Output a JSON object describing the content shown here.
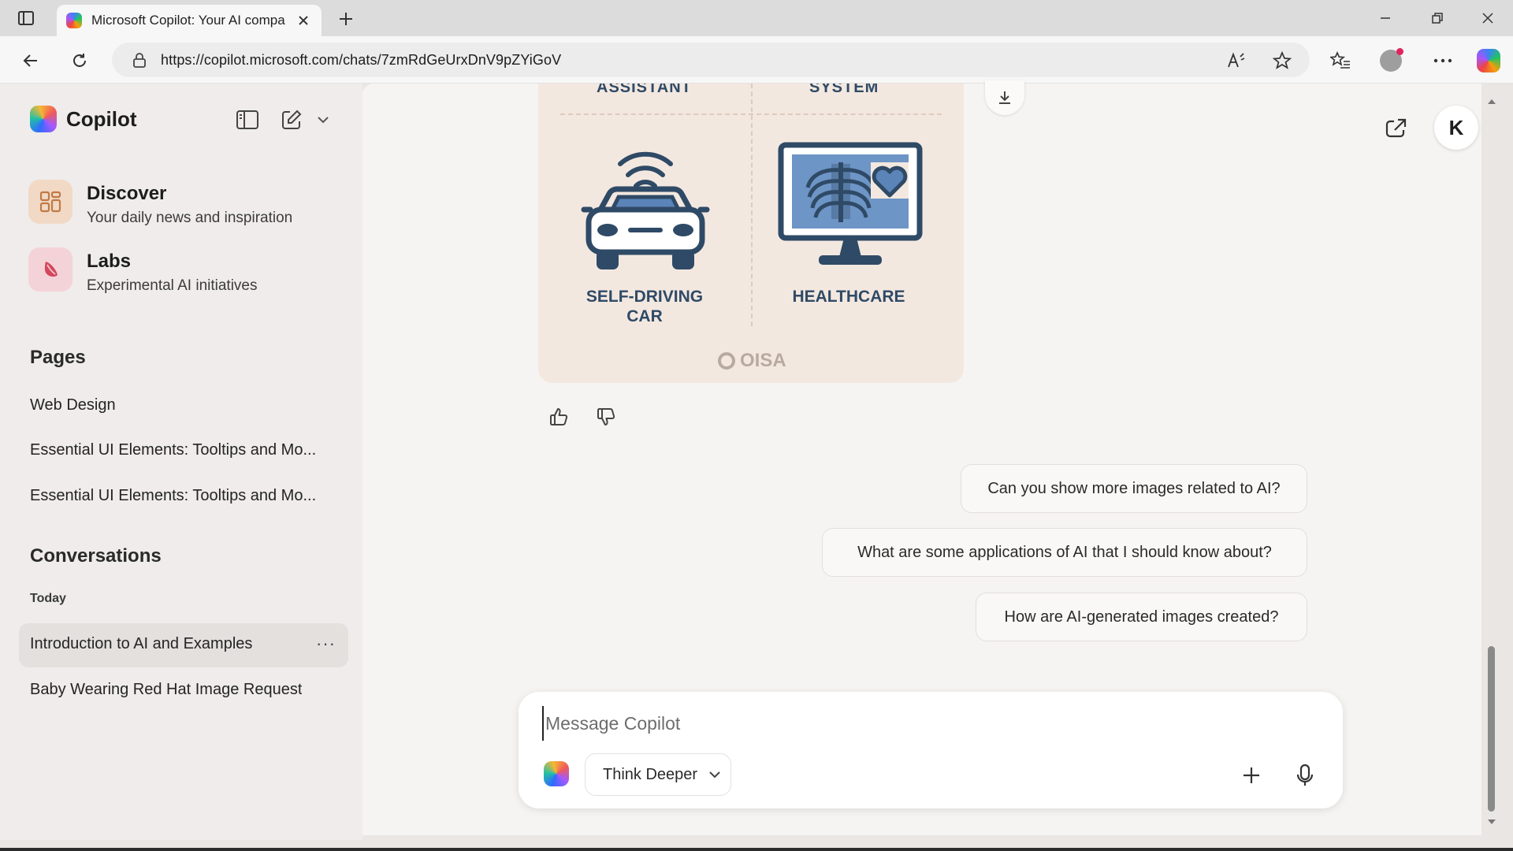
{
  "browser": {
    "tab_title": "Microsoft Copilot: Your AI compa",
    "url": "https://copilot.microsoft.com/chats/7zmRdGeUrxDnV9pZYiGoV"
  },
  "sidebar": {
    "brand": "Copilot",
    "discover": {
      "title": "Discover",
      "subtitle": "Your daily news and inspiration"
    },
    "labs": {
      "title": "Labs",
      "subtitle": "Experimental AI initiatives"
    },
    "pages_heading": "Pages",
    "pages": [
      "Web Design",
      "Essential UI Elements: Tooltips and Mo...",
      "Essential UI Elements: Tooltips and Mo..."
    ],
    "conversations_heading": "Conversations",
    "today_label": "Today",
    "conversations": [
      "Introduction to AI and Examples",
      "Baby Wearing Red Hat Image Request"
    ],
    "more_label": "···"
  },
  "image": {
    "top_left_label": "ASSISTANT",
    "top_right_label": "SYSTEM",
    "left_label_line1": "SELF-DRIVING",
    "left_label_line2": "CAR",
    "right_label": "HEALTHCARE",
    "logo_text": "OISA"
  },
  "header": {
    "avatar_initial": "K"
  },
  "suggestions": [
    "Can you show more images related to AI?",
    "What are some applications of AI that I should know about?",
    "How are AI-generated images created?"
  ],
  "composer": {
    "placeholder": "Message Copilot",
    "mode_label": "Think Deeper"
  },
  "colors": {
    "image_bg": "#f3e8e0",
    "image_ink": "#2f4a66",
    "sidebar_bg": "#efeceb"
  }
}
